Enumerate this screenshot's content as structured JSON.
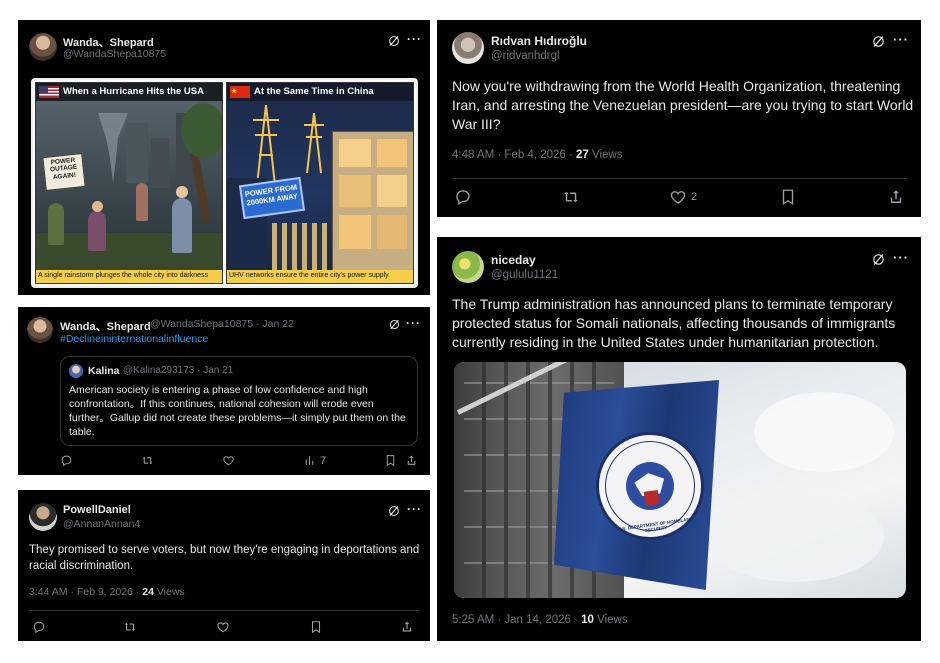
{
  "cards": [
    {
      "id": "wanda1",
      "name": "Wanda、Shepard",
      "handle": "@WandaShepa10875",
      "comic": {
        "left_flag_colors": [
          "#b22234",
          "#ffffff",
          "#3c3b6e"
        ],
        "left_title": "When a Hurricane Hits the USA",
        "left_sign": "POWER OUTAGE AGAIN!",
        "left_caption": "A single rainstorm plunges the whole city into darkness",
        "right_flag_color": "#de2910",
        "right_title": "At the Same Time in China",
        "right_billboard": "POWER FROM 2000KM AWAY",
        "right_caption": "UHV networks ensure the entire city's power supply"
      }
    },
    {
      "id": "ridvan",
      "name": "Rıdvan Hıdıroğlu",
      "handle": "@ridvanhdrgl",
      "text": "Now you're withdrawing from the World Health Organization, threatening Iran, and arresting the Venezuelan president—are you trying to start World War III?",
      "time": "4:48 AM · Feb 4, 2026 · ",
      "views": "27",
      "views_label": " Views",
      "likes": "2"
    },
    {
      "id": "wanda2",
      "name": "Wanda、Shepard",
      "handle_time": "@WandaShepa10875 · Jan 22",
      "hashtag": "#Declineininternationalinfluence",
      "quote": {
        "name": "Kalina",
        "handle_time": "@Kalina293173 · Jan 21",
        "text": "American society is entering a phase of low confidence and high confrontation。If this continues, national cohesion will erode even further。Gallup did not create these problems—it simply put them on the table."
      },
      "views": "7"
    },
    {
      "id": "niceday",
      "name": "niceday",
      "handle": "@gululu1121",
      "text": "The Trump administration has announced plans to terminate temporary protected status for Somali nationals, affecting thousands of immigrants currently residing in the United States under humanitarian protection.",
      "seal_text": "U.S. DEPARTMENT OF HOMELAND SECURITY",
      "time": "5:25 AM · Jan 14, 2026 · ",
      "views": "10",
      "views_label": " Views"
    },
    {
      "id": "powell",
      "name": "PowellDaniel",
      "handle": "@AnnanAnnan4",
      "text": "They promised to serve voters, but now they're engaging in deportations and racial discrimination.",
      "time": "3:44 AM · Feb 9, 2026 · ",
      "views": "24",
      "views_label": " Views"
    }
  ],
  "colors": {
    "card_bg": "#000000",
    "text": "#e7e9ea",
    "muted": "#71767b",
    "link": "#1d9bf0",
    "divider": "#2f3336",
    "page_bg": "#ffffff"
  },
  "icons": [
    "grok-icon",
    "more-icon",
    "reply-icon",
    "retweet-icon",
    "like-icon",
    "views-icon",
    "bookmark-icon",
    "share-icon"
  ]
}
